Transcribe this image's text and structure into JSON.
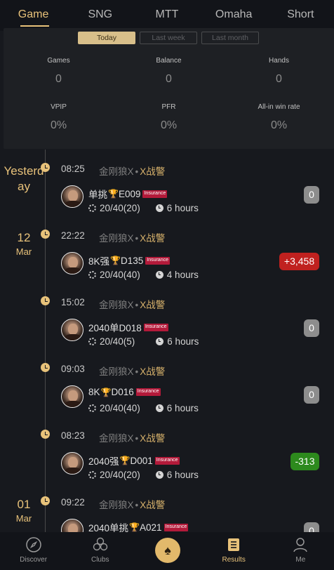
{
  "tabs": [
    {
      "label": "Game",
      "active": true
    },
    {
      "label": "SNG",
      "active": false
    },
    {
      "label": "MTT",
      "active": false
    },
    {
      "label": "Omaha",
      "active": false
    },
    {
      "label": "Short",
      "active": false
    }
  ],
  "filters": [
    {
      "label": "Today",
      "active": true
    },
    {
      "label": "Last week",
      "active": false
    },
    {
      "label": "Last month",
      "active": false
    }
  ],
  "stats": {
    "games": {
      "label": "Games",
      "value": "0"
    },
    "balance": {
      "label": "Balance",
      "value": "0"
    },
    "hands": {
      "label": "Hands",
      "value": "0"
    },
    "vpip": {
      "label": "VPIP",
      "value": "0%"
    },
    "pfr": {
      "label": "PFR",
      "value": "0%"
    },
    "allin": {
      "label": "All-in win rate",
      "value": "0%"
    }
  },
  "dates": [
    {
      "line1": "Yesterd",
      "line2": "ay"
    },
    {
      "line1": "12",
      "line2": "Mar"
    },
    {
      "line1": "01",
      "line2": "Mar"
    }
  ],
  "entries": [
    {
      "time": "08:25",
      "club_a": "金刚狼X",
      "sep": "•",
      "club_b": "X战警",
      "name_pre": "单挑",
      "name_post": "E009",
      "badge": "Insurance",
      "blinds": "20/40(20)",
      "duration": "6 hours",
      "result": "0"
    },
    {
      "time": "22:22",
      "club_a": "金刚狼X",
      "sep": "•",
      "club_b": "X战警",
      "name_pre": "8K强",
      "name_post": "D135",
      "badge": "Insurance",
      "blinds": "20/40(40)",
      "duration": "4 hours",
      "result": "+3,458"
    },
    {
      "time": "15:02",
      "club_a": "金刚狼X",
      "sep": "•",
      "club_b": "X战警",
      "name_pre": "2040单D018",
      "name_post": "",
      "badge": "Insurance",
      "blinds": "20/40(5)",
      "duration": "6 hours",
      "result": "0"
    },
    {
      "time": "09:03",
      "club_a": "金刚狼X",
      "sep": "•",
      "club_b": "X战警",
      "name_pre": "8K",
      "name_post": "D016",
      "badge": "Insurance",
      "blinds": "20/40(40)",
      "duration": "6 hours",
      "result": "0"
    },
    {
      "time": "08:23",
      "club_a": "金刚狼X",
      "sep": "•",
      "club_b": "X战警",
      "name_pre": "2040强",
      "name_post": "D001",
      "badge": "Insurance",
      "blinds": "20/40(20)",
      "duration": "6 hours",
      "result": "-313"
    },
    {
      "time": "09:22",
      "club_a": "金刚狼X",
      "sep": "•",
      "club_b": "X战警",
      "name_pre": "2040单挑",
      "name_post": "A021",
      "badge": "Insurance",
      "blinds": "",
      "duration": "",
      "result": "0"
    }
  ],
  "nav": [
    {
      "label": "Discover",
      "icon": "compass-icon",
      "active": false
    },
    {
      "label": "Clubs",
      "icon": "clubs-icon",
      "active": false
    },
    {
      "label": "",
      "icon": "spade-icon",
      "active": false
    },
    {
      "label": "Results",
      "icon": "results-icon",
      "active": true
    },
    {
      "label": "Me",
      "icon": "person-icon",
      "active": false
    }
  ],
  "colors": {
    "accent": "#e8c27a",
    "win": "#c0211f",
    "loss": "#2d8a1d",
    "neutral": "#8d8d8d",
    "insurance": "#b31a3a"
  }
}
